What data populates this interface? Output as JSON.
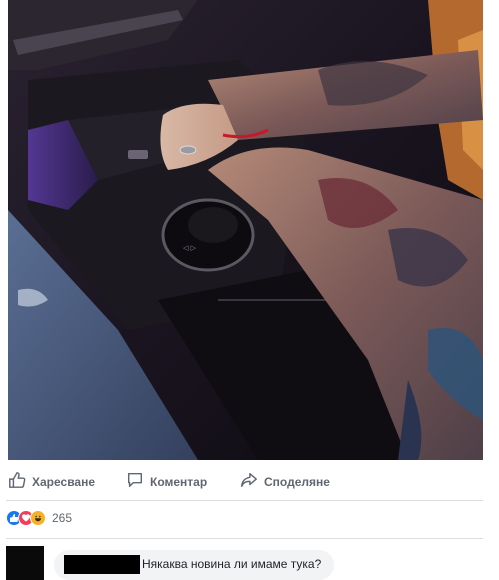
{
  "post": {
    "actions": {
      "like_label": "Харесване",
      "comment_label": "Коментар",
      "share_label": "Споделяне"
    },
    "reactions": {
      "icons": [
        "like-icon",
        "love-icon",
        "haha-icon"
      ],
      "count": "265"
    }
  },
  "comment": {
    "author": "",
    "text": "Някаква новина ли имаме тука?"
  },
  "colors": {
    "like_blue": "#1877f2",
    "love_red": "#f33e58",
    "haha_yellow": "#f7b125",
    "action_gray": "#606770",
    "divider": "#dadde1",
    "bubble": "#f2f3f5"
  }
}
